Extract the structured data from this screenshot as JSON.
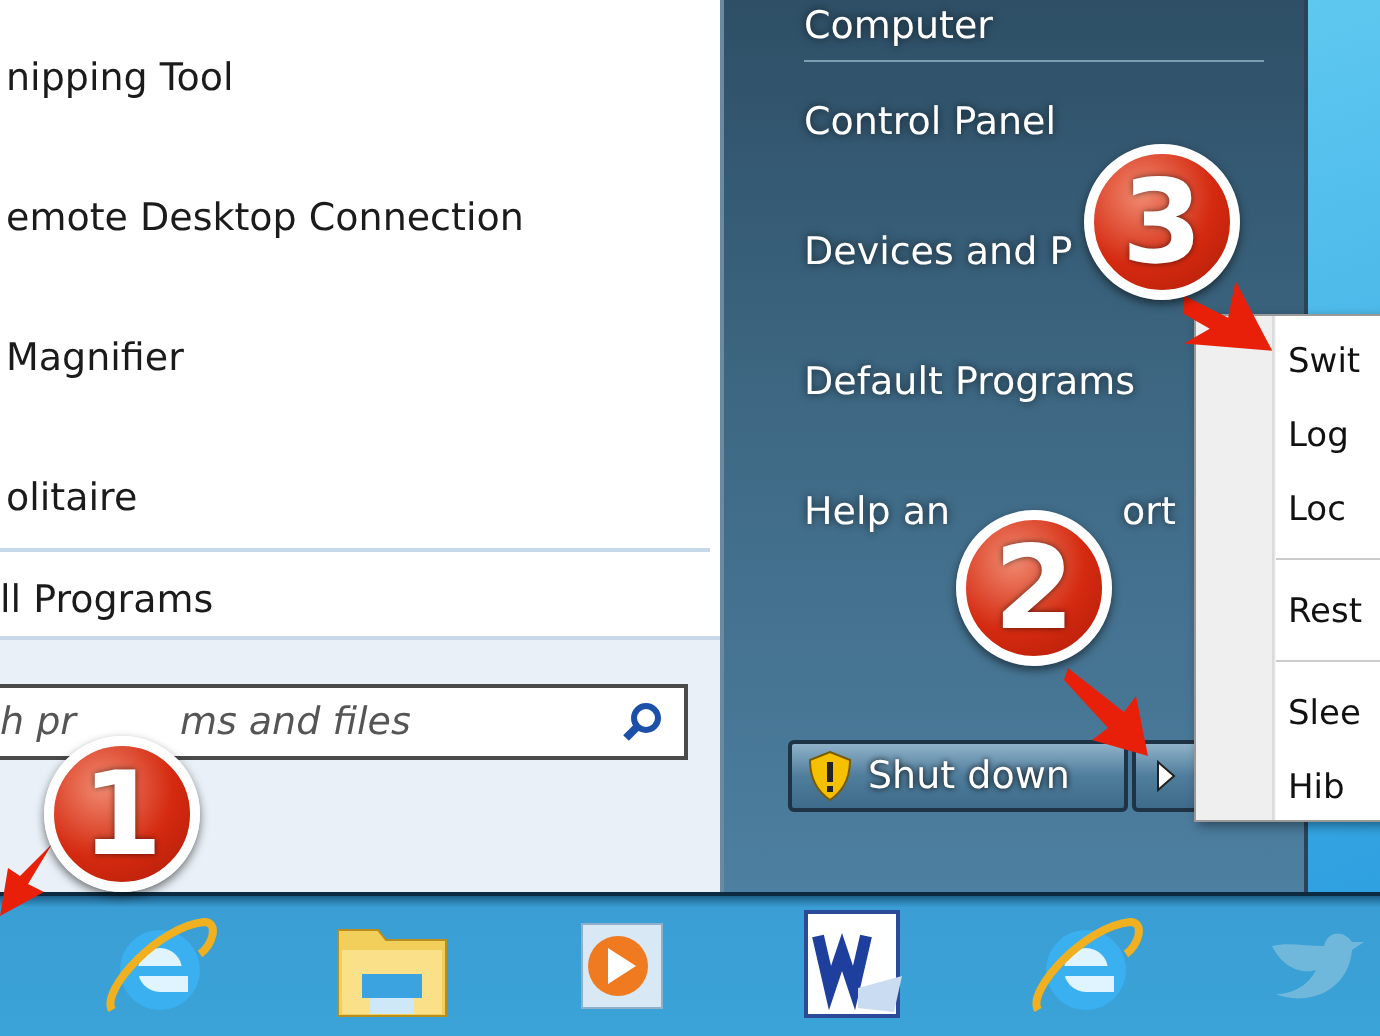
{
  "programs": [
    {
      "label": "nipping Tool"
    },
    {
      "label": "emote Desktop Connection"
    },
    {
      "label": "Magnifier"
    },
    {
      "label": "olitaire"
    }
  ],
  "all_programs": "ll Programs",
  "search": {
    "placeholder_parts": [
      "h pr",
      "ms and files"
    ]
  },
  "places": [
    {
      "parts": [
        "Computer"
      ],
      "divider_after": true
    },
    {
      "parts": [
        "Control Panel"
      ],
      "divider_after": false
    },
    {
      "parts": [
        "Devices and P"
      ],
      "divider_after": false
    },
    {
      "parts": [
        "Default Programs"
      ],
      "divider_after": false
    },
    {
      "parts": [
        "Help an",
        "ort"
      ],
      "divider_after": false
    }
  ],
  "shutdown": {
    "label": "Shut down"
  },
  "power_menu": [
    {
      "label": "Swit",
      "divider_after": false
    },
    {
      "label": "Log",
      "divider_after": false
    },
    {
      "label": "Loc",
      "divider_after": true
    },
    {
      "label": "Rest",
      "divider_after": true
    },
    {
      "label": "Slee",
      "divider_after": false
    },
    {
      "label": "Hib",
      "divider_after": false
    }
  ],
  "taskbar": [
    {
      "kind": "ie"
    },
    {
      "kind": "folder"
    },
    {
      "kind": "media"
    },
    {
      "kind": "word"
    },
    {
      "kind": "ie"
    },
    {
      "kind": "bird"
    }
  ],
  "callouts": [
    {
      "number": "1"
    },
    {
      "number": "2"
    },
    {
      "number": "3"
    }
  ]
}
